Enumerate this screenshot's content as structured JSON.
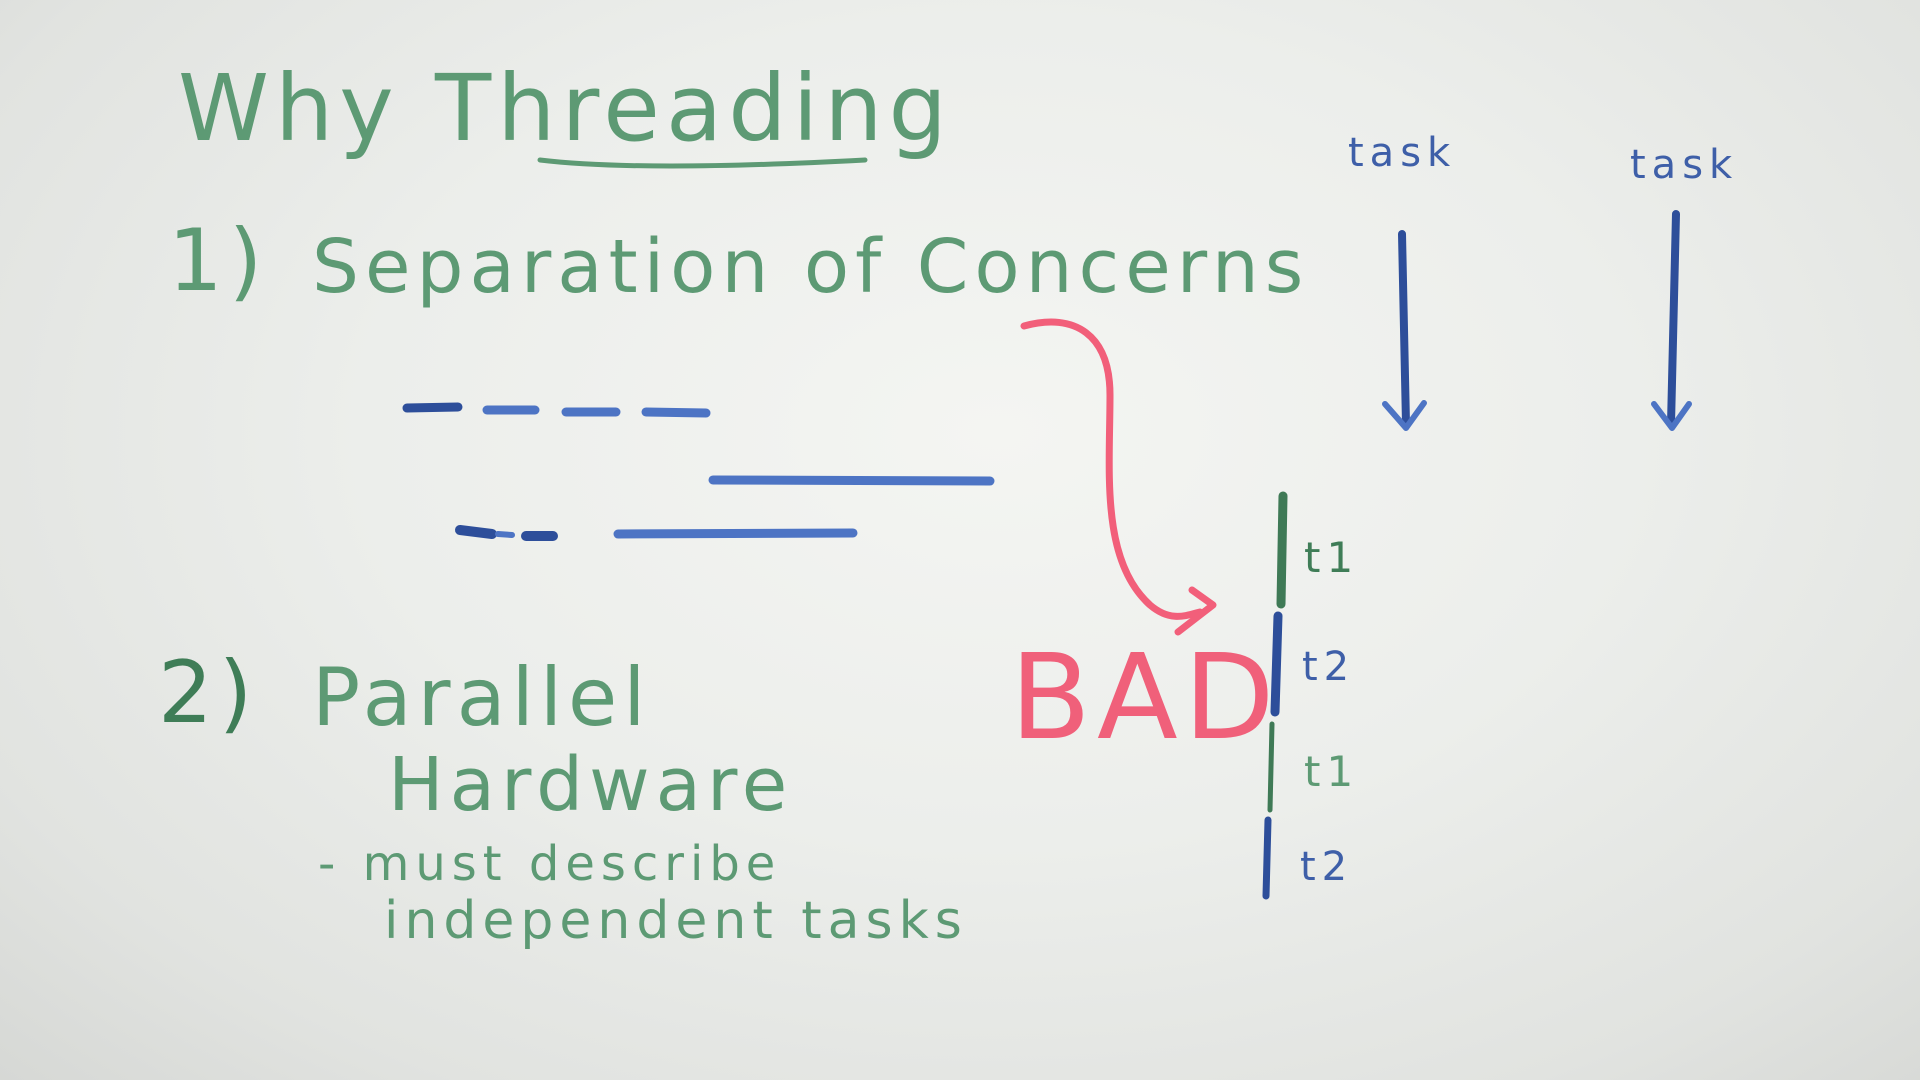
{
  "board": {
    "title": "Why Threading",
    "point1": {
      "number": "1)",
      "text": "Separation of Concerns"
    },
    "point2": {
      "number": "2)",
      "line1": "Parallel",
      "line2": "Hardware",
      "bullet": "- must describe",
      "bullet_cont": "independent tasks"
    },
    "annotation": "BAD",
    "task_labels": [
      "task",
      "task"
    ],
    "timeline_labels": [
      "t1",
      "t2",
      "t1",
      "t2"
    ]
  }
}
